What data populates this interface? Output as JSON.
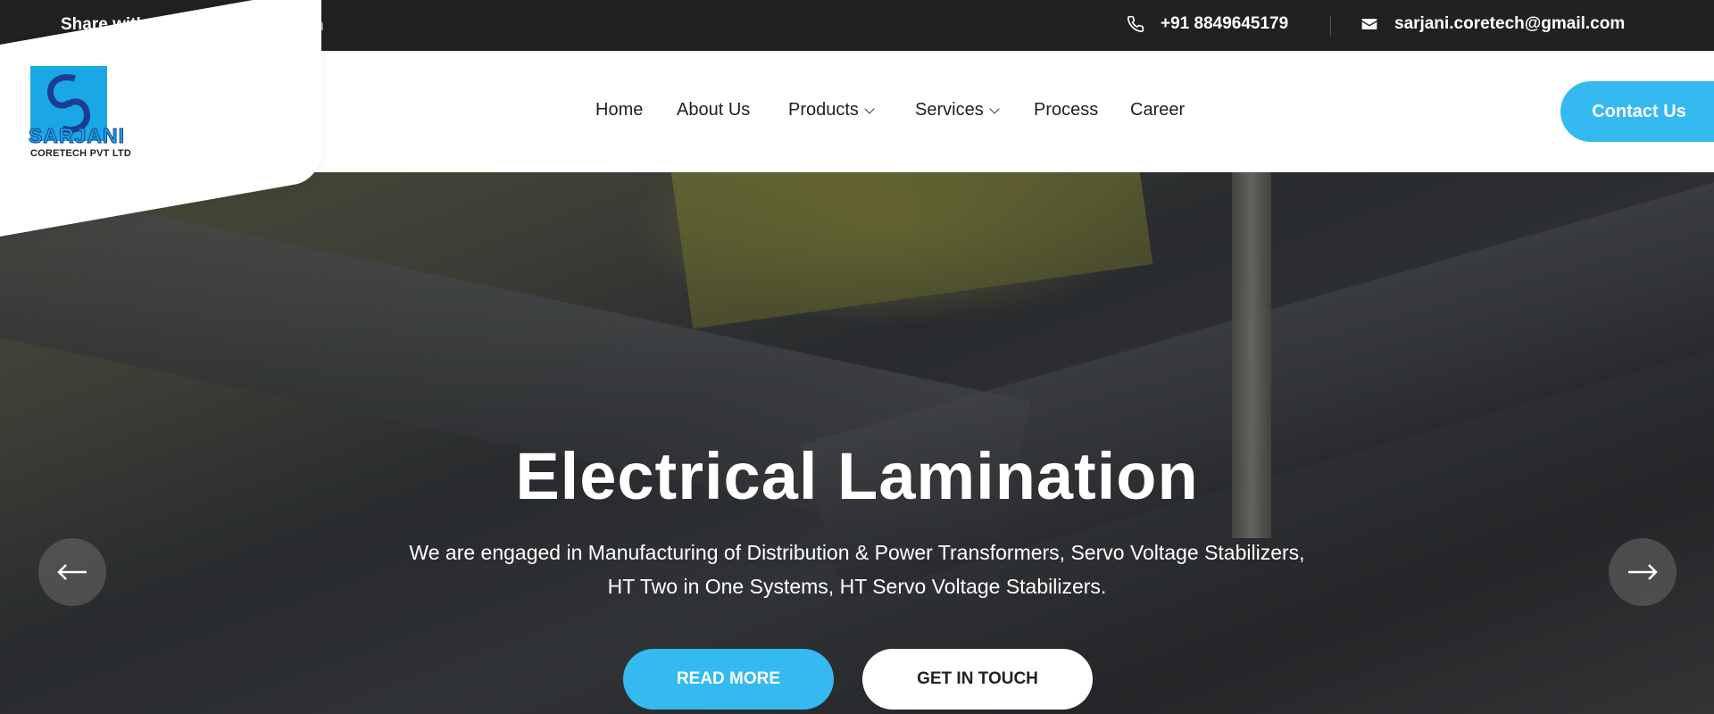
{
  "topbar": {
    "share_label": "Share with on:",
    "social": [
      {
        "icon": "twitter-icon"
      },
      {
        "icon": "facebook-icon"
      },
      {
        "icon": "linkedin-icon",
        "glyph": "in"
      }
    ],
    "phone": "+91 8849645179",
    "email": "sarjani.coretech@gmail.com"
  },
  "logo": {
    "name": "SARJANI",
    "subtitle": "CORETECH PVT LTD"
  },
  "nav": {
    "items": [
      {
        "label": "Home"
      },
      {
        "label": "About Us"
      },
      {
        "label": "Products",
        "dropdown": true
      },
      {
        "label": "Services",
        "dropdown": true
      },
      {
        "label": "Process"
      },
      {
        "label": "Career"
      }
    ],
    "contact_button": "Contact Us"
  },
  "hero": {
    "title": "Electrical Lamination",
    "text_line1": "We are engaged in Manufacturing of Distribution & Power Transformers, Servo Voltage Stabilizers,",
    "text_line2": "HT Two in One Systems, HT Servo Voltage Stabilizers.",
    "read_more": "READ MORE",
    "get_in_touch": "GET IN TOUCH"
  },
  "colors": {
    "topbar_bg": "#212121",
    "accent": "#34b9f0",
    "logo_blue": "#1aa7e6"
  }
}
